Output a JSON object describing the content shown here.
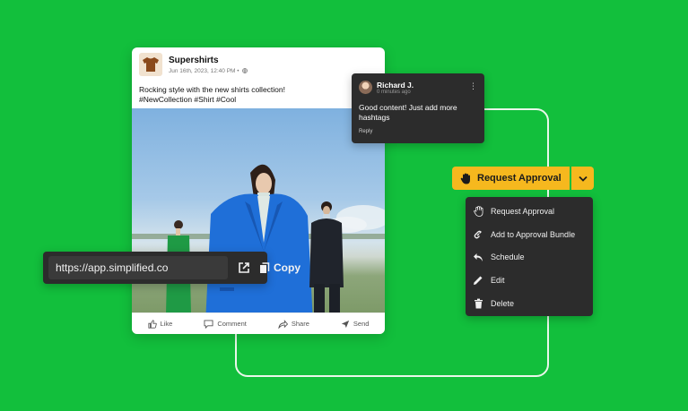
{
  "post": {
    "brand_name": "Supershirts",
    "date": "Jun 16th, 2023, 12:40 PM •",
    "caption_line1": "Rocking style with the new shirts collection!",
    "caption_line2": "#NewCollection #Shirt #Cool",
    "actions": {
      "like": "Like",
      "comment": "Comment",
      "share": "Share",
      "send": "Send"
    }
  },
  "comment": {
    "author": "Richard J.",
    "time": "0 minutes ago",
    "body": "Good content! Just add more hashtags",
    "reply_label": "Reply"
  },
  "url_bar": {
    "value": "https://app.simplified.co",
    "copy_label": "Copy"
  },
  "approval": {
    "button_label": "Request Approval",
    "accent_color": "#f6b81e"
  },
  "menu": {
    "items": [
      {
        "label": "Request Approval",
        "icon": "hand-icon"
      },
      {
        "label": "Add to Approval Bundle",
        "icon": "link-icon"
      },
      {
        "label": "Schedule",
        "icon": "reply-arrow-icon"
      },
      {
        "label": "Edit",
        "icon": "pencil-icon"
      },
      {
        "label": "Delete",
        "icon": "trash-icon"
      }
    ]
  },
  "colors": {
    "background": "#12bf3c",
    "panel": "#2c2c2c"
  }
}
